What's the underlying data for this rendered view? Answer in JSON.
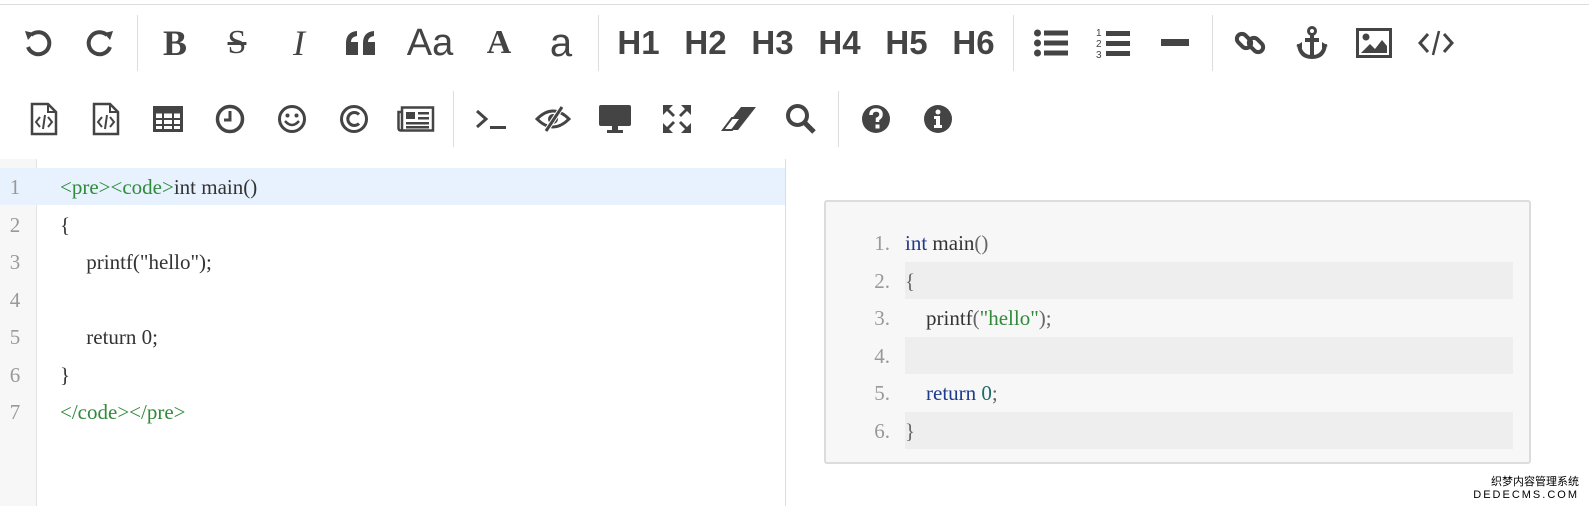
{
  "toolbar": {
    "heading_labels": [
      "H1",
      "H2",
      "H3",
      "H4",
      "H5",
      "H6"
    ],
    "bold_label": "B",
    "strike_label": "S",
    "italic_label": "I",
    "case_label": "Aa",
    "uppercase_label": "A",
    "lowercase_label": "a",
    "icons_row1": [
      "undo-icon",
      "redo-icon",
      "bold-icon",
      "strikethrough-icon",
      "italic-icon",
      "quote-icon",
      "case-icon",
      "uppercase-icon",
      "lowercase-icon",
      "h1..h6",
      "unordered-list-icon",
      "ordered-list-icon",
      "horizontal-rule-icon",
      "link-icon",
      "anchor-icon",
      "image-icon",
      "code-icon"
    ],
    "icons_row2": [
      "code-file-icon",
      "code-block-icon",
      "table-icon",
      "datetime-icon",
      "emoji-icon",
      "html-entities-icon",
      "pagebreak-icon",
      "terminal-icon",
      "preview-hide-icon",
      "watch-icon",
      "fullscreen-icon",
      "eraser-icon",
      "search-icon",
      "help-icon",
      "info-icon"
    ],
    "icon_color": "#444444"
  },
  "editor": {
    "lines": [
      {
        "n": "1",
        "tokens": [
          {
            "t": "<pre><code>",
            "k": "tag"
          },
          {
            "t": "int main()",
            "k": ""
          }
        ],
        "active": true
      },
      {
        "n": "2",
        "tokens": [
          {
            "t": "{",
            "k": ""
          }
        ]
      },
      {
        "n": "3",
        "tokens": [
          {
            "t": "     printf(\"hello\");",
            "k": ""
          }
        ]
      },
      {
        "n": "4",
        "tokens": [
          {
            "t": "",
            "k": ""
          }
        ]
      },
      {
        "n": "5",
        "tokens": [
          {
            "t": "     return 0;",
            "k": ""
          }
        ]
      },
      {
        "n": "6",
        "tokens": [
          {
            "t": "}",
            "k": ""
          }
        ]
      },
      {
        "n": "7",
        "tokens": [
          {
            "t": "</code></pre>",
            "k": "tag"
          }
        ]
      }
    ],
    "active_line_color": "#e8f2ff",
    "tag_color": "#2f8a3a"
  },
  "preview": {
    "lines": [
      {
        "n": "1.",
        "tokens": [
          {
            "t": "int",
            "k": "kw"
          },
          {
            "t": " main",
            "k": ""
          },
          {
            "t": "()",
            "k": "pun"
          }
        ]
      },
      {
        "n": "2.",
        "tokens": [
          {
            "t": "{",
            "k": "pun"
          }
        ]
      },
      {
        "n": "3.",
        "tokens": [
          {
            "t": "    printf",
            "k": ""
          },
          {
            "t": "(",
            "k": "pun"
          },
          {
            "t": "\"hello\"",
            "k": "str"
          },
          {
            "t": ");",
            "k": "pun"
          }
        ]
      },
      {
        "n": "4.",
        "tokens": []
      },
      {
        "n": "5.",
        "tokens": [
          {
            "t": "    return",
            "k": "kw"
          },
          {
            "t": " 0",
            "k": "num"
          },
          {
            "t": ";",
            "k": "pun"
          }
        ]
      },
      {
        "n": "6.",
        "tokens": [
          {
            "t": "}",
            "k": "pun"
          }
        ]
      }
    ]
  },
  "watermark": {
    "line1": "织梦内容管理系统",
    "line2": "DEDECMS.COM"
  }
}
